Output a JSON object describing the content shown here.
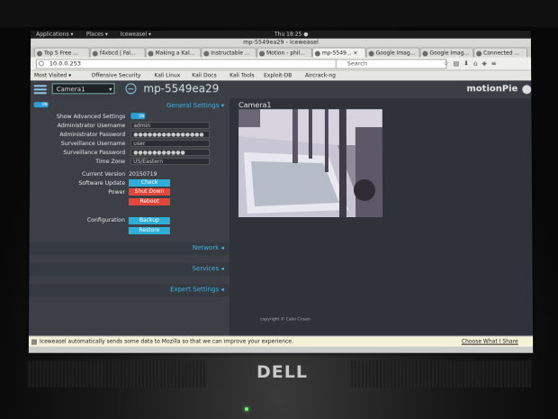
{
  "gnome_bar": {
    "applications": "Applications ▾",
    "places": "Places ▾",
    "app_menu": "Iceweasel ▾",
    "clock": "Thu 18:25 ●"
  },
  "window": {
    "title": "mp-5549ea29 - Iceweasel"
  },
  "tabs": [
    {
      "label": "Top 5 Free ..."
    },
    {
      "label": "f4xbcd | Fal..."
    },
    {
      "label": "Making a Kal..."
    },
    {
      "label": "Instructable ..."
    },
    {
      "label": "Motion - phil..."
    },
    {
      "label": "mp-5549... ×"
    },
    {
      "label": "Google Imag..."
    },
    {
      "label": "Google Imag..."
    },
    {
      "label": "Connected ..."
    }
  ],
  "navbar": {
    "url": "10.0.0.253",
    "search_placeholder": "Search"
  },
  "bookmarks": [
    {
      "label": "Most Visited ▾"
    },
    {
      "label": "Offensive Security"
    },
    {
      "label": "Kali Linux"
    },
    {
      "label": "Kali Docs"
    },
    {
      "label": "Kali Tools"
    },
    {
      "label": "Exploit-DB"
    },
    {
      "label": "Aircrack-ng"
    }
  ],
  "app": {
    "camera_select": "Camera1",
    "hostname": "mp-5549ea29",
    "brand": "motionPie",
    "settings": {
      "general_title": "General Settings ▾",
      "show_advanced_label": "Show Advanced Settings",
      "admin_user_label": "Administrator Username",
      "admin_user_value": "admin",
      "admin_pass_label": "Administrator Password",
      "admin_pass_value": "●●●●●●●●●●●●●●●",
      "surv_user_label": "Surveillance Username",
      "surv_user_value": "user",
      "surv_pass_label": "Surveillance Password",
      "surv_pass_value": "●●●●●●●●●●●",
      "timezone_label": "Time Zone",
      "timezone_value": "US/Eastern",
      "version_label": "Current Version",
      "version_value": "20150719",
      "update_label": "Software Update",
      "check_button": "Check",
      "power_label": "Power",
      "shutdown_button": "Shut Down",
      "reboot_button": "Reboot",
      "config_label": "Configuration",
      "backup_button": "Backup",
      "restore_button": "Restore",
      "network_title": "Network ◂",
      "services_title": "Services ◂",
      "expert_title": "Expert Settings ◂"
    },
    "camera_panel": {
      "title": "Camera1",
      "copyright": "copyright © Calin Crisan"
    }
  },
  "notification": {
    "message": "Iceweasel automatically sends some data to Mozilla so that we can improve your experience.",
    "button": "Choose What I Share"
  },
  "laptop": {
    "brand": "DELL"
  }
}
